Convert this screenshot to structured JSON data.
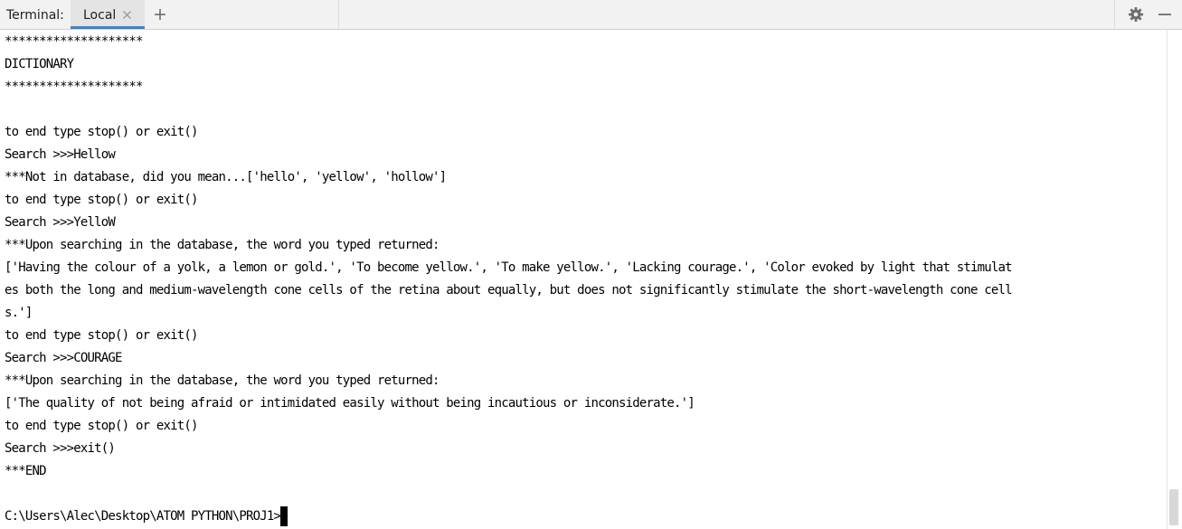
{
  "header": {
    "title": "Terminal:",
    "tabs": [
      {
        "label": "Local",
        "active": true
      }
    ],
    "icons": {
      "close": "close-icon",
      "add": "plus-icon",
      "settings": "gear-icon",
      "hide": "minimize-icon"
    },
    "accent_color": "#4083c9"
  },
  "terminal": {
    "lines": [
      "********************",
      "DICTIONARY",
      "********************",
      "",
      "to end type stop() or exit()",
      "Search >>>Hellow",
      "***Not in database, did you mean...['hello', 'yellow', 'hollow']",
      "to end type stop() or exit()",
      "Search >>>YelloW",
      "***Upon searching in the database, the word you typed returned:",
      "['Having the colour of a yolk, a lemon or gold.', 'To become yellow.', 'To make yellow.', 'Lacking courage.', 'Color evoked by light that stimulat",
      "es both the long and medium-wavelength cone cells of the retina about equally, but does not significantly stimulate the short-wavelength cone cell",
      "s.']",
      "to end type stop() or exit()",
      "Search >>>COURAGE",
      "***Upon searching in the database, the word you typed returned:",
      "['The quality of not being afraid or intimidated easily without being incautious or inconsiderate.']",
      "to end type stop() or exit()",
      "Search >>>exit()",
      "***END",
      ""
    ],
    "prompt": "C:\\Users\\Alec\\Desktop\\ATOM PYTHON\\PROJ1>"
  }
}
